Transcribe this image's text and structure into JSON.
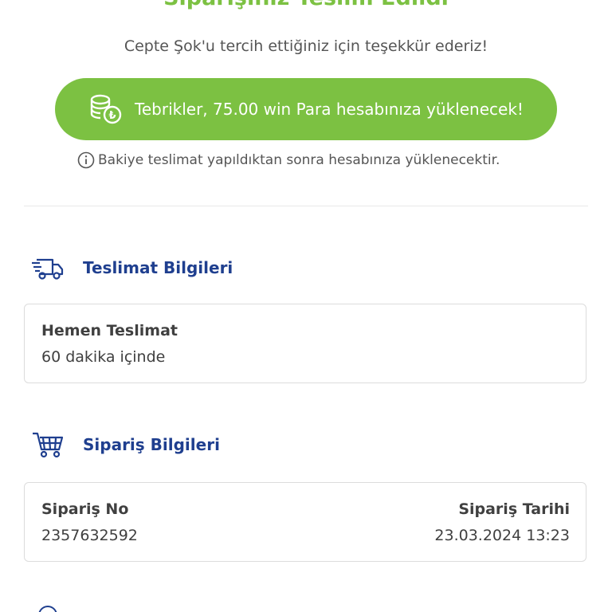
{
  "header": {
    "title": "Siparişiniz Teslim Edildi",
    "thanks": "Cepte Şok'u tercih ettiğiniz için teşekkür ederiz!"
  },
  "reward": {
    "icon": "coins-lira-icon",
    "text": "Tebrikler, 75.00 win Para hesabınıza yüklenecek!"
  },
  "info_note": {
    "icon": "info-icon",
    "text": "Bakiye teslimat yapıldıktan sonra hesabınıza yüklenecektir."
  },
  "delivery": {
    "icon": "delivery-truck-icon",
    "title": "Teslimat Bilgileri",
    "type": "Hemen Teslimat",
    "eta": "60 dakika içinde"
  },
  "order": {
    "icon": "shopping-cart-icon",
    "title": "Sipariş Bilgileri",
    "no_label": "Sipariş No",
    "no_value": "2357632592",
    "date_label": "Sipariş Tarihi",
    "date_value": "23.03.2024 13:23"
  },
  "colors": {
    "accent_green": "#7cc142",
    "brand_blue": "#1f3f8f"
  }
}
